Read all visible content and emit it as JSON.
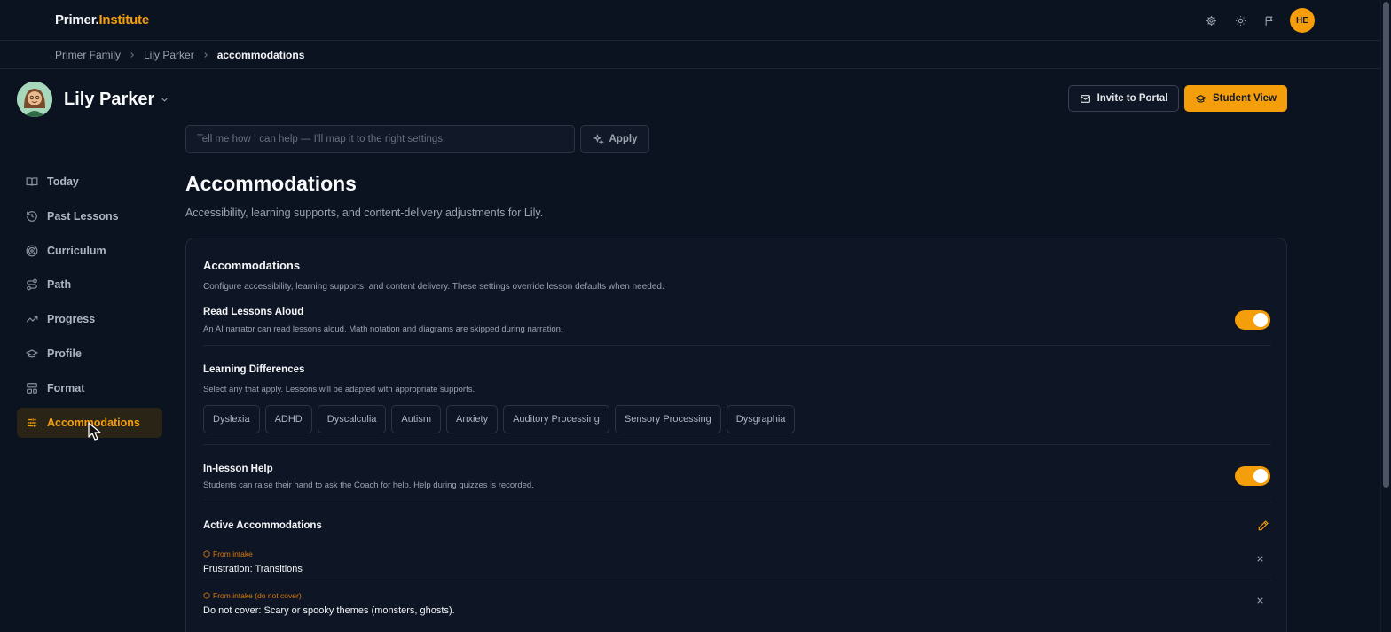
{
  "app": {
    "logo_part1": "Primer.",
    "logo_part2": "Institute",
    "user_initials": "HE"
  },
  "breadcrumb": {
    "items": [
      "Primer Family",
      "Lily Parker",
      "accommodations"
    ]
  },
  "student": {
    "name": "Lily Parker"
  },
  "actions": {
    "invite_label": "Invite to Portal",
    "student_view_label": "Student View"
  },
  "help": {
    "placeholder": "Tell me how I can help — I'll map it to the right settings.",
    "apply_label": "Apply"
  },
  "sidebar": {
    "items": [
      {
        "label": "Today",
        "icon": "book-open-icon"
      },
      {
        "label": "Past Lessons",
        "icon": "history-icon"
      },
      {
        "label": "Curriculum",
        "icon": "target-icon"
      },
      {
        "label": "Path",
        "icon": "route-icon"
      },
      {
        "label": "Progress",
        "icon": "trending-up-icon"
      },
      {
        "label": "Profile",
        "icon": "graduation-cap-icon"
      },
      {
        "label": "Format",
        "icon": "layout-icon"
      },
      {
        "label": "Accommodations",
        "icon": "sliders-icon",
        "active": true
      }
    ]
  },
  "page": {
    "title": "Accommodations",
    "subtitle": "Accessibility, learning supports, and content-delivery adjustments for Lily."
  },
  "card": {
    "title": "Accommodations",
    "description": "Configure accessibility, learning supports, and content delivery. These settings override lesson defaults when needed.",
    "read_aloud": {
      "title": "Read Lessons Aloud",
      "description": "An AI narrator can read lessons aloud. Math notation and diagrams are skipped during narration.",
      "enabled": true
    },
    "learning_differences": {
      "title": "Learning Differences",
      "description": "Select any that apply. Lessons will be adapted with appropriate supports.",
      "options": [
        "Dyslexia",
        "ADHD",
        "Dyscalculia",
        "Autism",
        "Anxiety",
        "Auditory Processing",
        "Sensory Processing",
        "Dysgraphia"
      ]
    },
    "in_lesson_help": {
      "title": "In-lesson Help",
      "description": "Students can raise their hand to ask the Coach for help. Help during quizzes is recorded.",
      "enabled": true
    },
    "active": {
      "title": "Active Accommodations",
      "items": [
        {
          "tag": "From intake",
          "text": "Frustration: Transitions"
        },
        {
          "tag": "From intake (do not cover)",
          "text": "Do not cover: Scary or spooky themes (monsters, ghosts)."
        }
      ]
    }
  },
  "colors": {
    "accent": "#f59e0b",
    "background": "#0b1220",
    "card": "#0e1626"
  }
}
